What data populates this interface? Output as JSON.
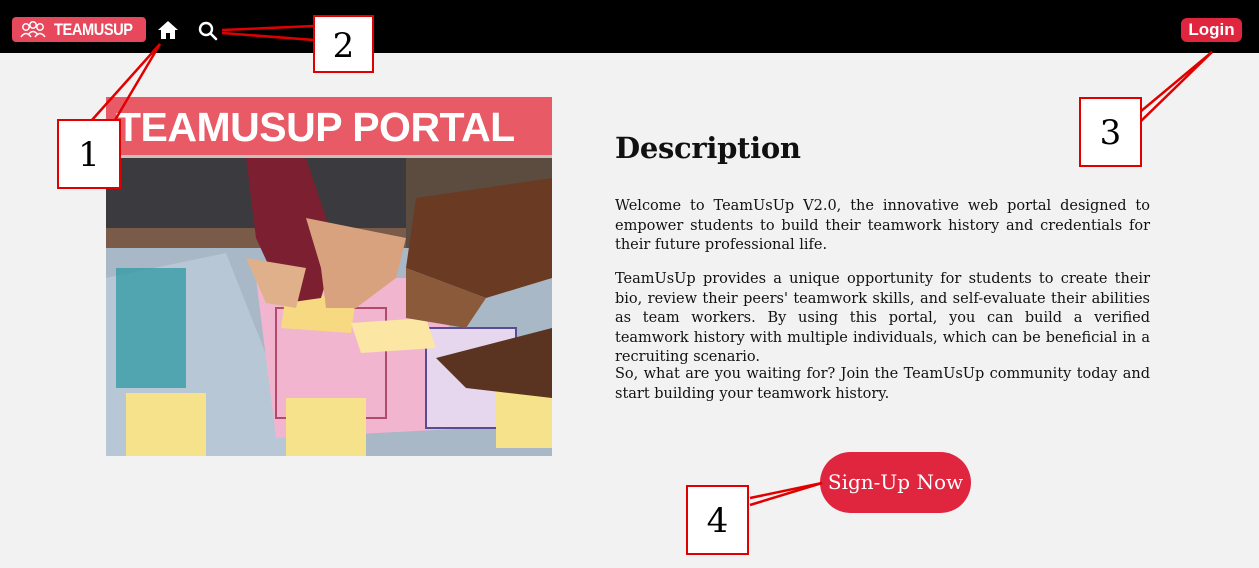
{
  "navbar": {
    "logo_text": "TEAMUSUP",
    "login_label": "Login"
  },
  "hero": {
    "banner_text": "TEAMUSUP PORTAL"
  },
  "description": {
    "title": "Description",
    "paragraphs": [
      "Welcome to TeamUsUp V2.0, the innovative web portal designed to empower students to build their teamwork history and credentials for their future professional life.",
      "TeamUsUp provides a unique opportunity for students to create their bio, review their peers' teamwork skills, and self-evaluate their abilities as team workers. By using this portal, you can build a verified teamwork history with multiple individuals, which can be beneficial in a recruiting scenario.",
      "So, what are you waiting for? Join the TeamUsUp community today and start building your teamwork history."
    ]
  },
  "signup": {
    "label": "Sign-Up Now"
  },
  "annotations": [
    "1",
    "2",
    "3",
    "4"
  ],
  "colors": {
    "accent": "#e0253f",
    "logo_bg": "#e8485c",
    "nav_bg": "#000000",
    "page_bg": "#f2f2f2",
    "callout_border": "#e00000"
  }
}
